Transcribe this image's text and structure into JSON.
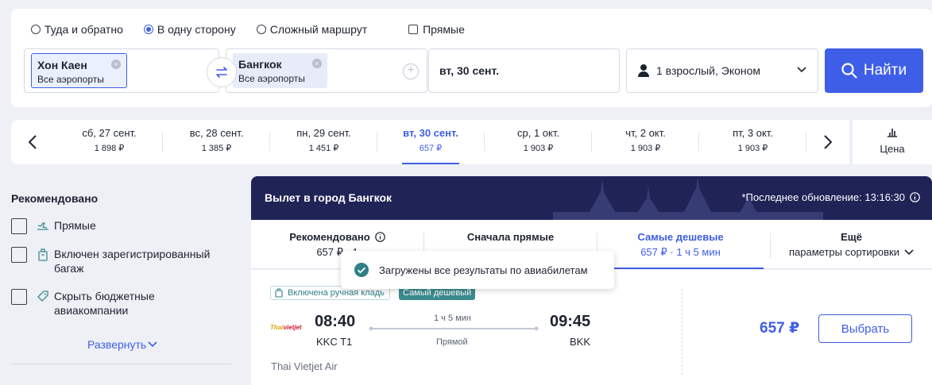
{
  "search": {
    "trip_types": [
      {
        "label": "Туда и обратно",
        "selected": false
      },
      {
        "label": "В одну сторону",
        "selected": true
      },
      {
        "label": "Сложный маршрут",
        "selected": false
      }
    ],
    "direct_label": "Прямые",
    "from": {
      "city": "Хон Каен",
      "sub": "Все аэропорты"
    },
    "to": {
      "city": "Бангкок",
      "sub": "Все аэропорты"
    },
    "date": "вт, 30 сент.",
    "passengers": "1 взрослый, Эконом",
    "search_label": "Найти",
    "accent_color": "#3f5ee8"
  },
  "date_strip": {
    "days": [
      {
        "label": "сб, 27 сент.",
        "price": "1 898 ₽"
      },
      {
        "label": "вс, 28 сент.",
        "price": "1 385 ₽"
      },
      {
        "label": "пн, 29 сент.",
        "price": "1 451 ₽"
      },
      {
        "label": "вт, 30 сент.",
        "price": "657 ₽"
      },
      {
        "label": "ср, 1 окт.",
        "price": "1 903 ₽"
      },
      {
        "label": "чт, 2 окт.",
        "price": "1 903 ₽"
      },
      {
        "label": "пт, 3 окт.",
        "price": "1 903 ₽"
      }
    ],
    "selected_index": 3,
    "price_tab_label": "Цена"
  },
  "filters": {
    "title": "Рекомендовано",
    "items": [
      {
        "label": "Прямые",
        "icon": "plane-icon"
      },
      {
        "label": "Включен зарегистрированный багаж",
        "icon": "luggage-icon"
      },
      {
        "label": "Скрыть бюджетные авиакомпании",
        "icon": "tag-icon"
      }
    ],
    "expand_label": "Развернуть"
  },
  "results": {
    "title": "Вылет в город Бангкок",
    "updated": "*Последнее обновление: 13:16:30",
    "sort": [
      {
        "title": "Рекомендовано",
        "sub": "657 ₽ · 1"
      },
      {
        "title": "Сначала прямые",
        "sub": ""
      },
      {
        "title": "Самые дешевые",
        "sub": "657 ₽ · 1 ч 5 мин"
      },
      {
        "title": "Ещё",
        "sub": "параметры сортировки"
      }
    ],
    "toast": "Загружены все результаты по авиабилетам",
    "ticket": {
      "badge_bag": "Включена ручная кладь",
      "badge_cheap": "Самый дешевый",
      "logo_text_1": "Thai",
      "logo_text_2": "vietjet",
      "dep_time": "08:40",
      "dep_code": "KKC T1",
      "arr_time": "09:45",
      "arr_code": "BKK",
      "duration": "1 ч 5 мин",
      "stops": "Прямой",
      "airline": "Thai Vietjet Air",
      "price": "657 ₽",
      "select_label": "Выбрать"
    }
  }
}
